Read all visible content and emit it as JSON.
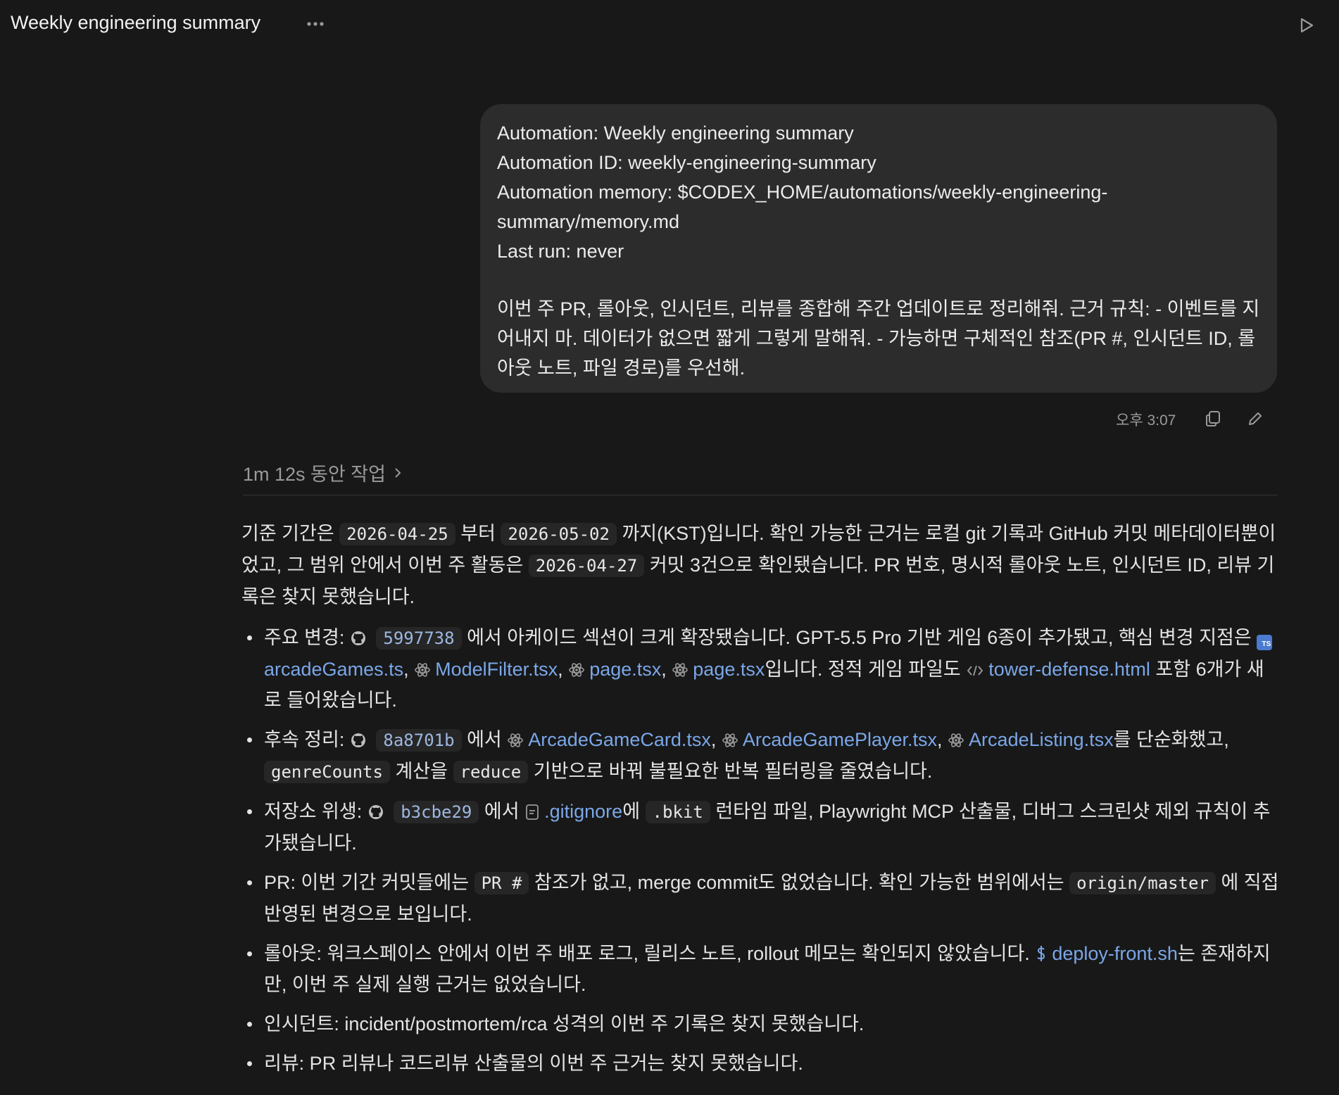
{
  "header": {
    "title": "Weekly engineering summary"
  },
  "message": {
    "line1": "Automation: Weekly engineering summary",
    "line2": "Automation ID: weekly-engineering-summary",
    "line3a": "Automation memory: $CODEX_HOME/automations/weekly-engineering-",
    "line3b": "summary/memory.md",
    "line4": "Last run: never",
    "body": "이번 주 PR, 롤아웃, 인시던트, 리뷰를 종합해 주간 업데이트로 정리해줘. 근거 규칙: - 이벤트를 지어내지 마. 데이터가 없으면 짧게 그렇게 말해줘. - 가능하면 구체적인 참조(PR #, 인시던트 ID, 롤아웃 노트, 파일 경로)를 우선해.",
    "time": "오후 3:07"
  },
  "worked": {
    "label": "1m 12s 동안 작업"
  },
  "answer": {
    "intro_1": "기준 기간은",
    "date_start": "2026-04-25",
    "intro_2": "부터",
    "date_end": "2026-05-02",
    "intro_3": "까지(KST)입니다. 확인 가능한 근거는 로컬 git 기록과 GitHub 커밋 메타데이터뿐이었고, 그 범위 안에서 이번 주 활동은",
    "date_commit": "2026-04-27",
    "intro_4": "커밋 3건으로 확인됐습니다. PR 번호, 명시적 롤아웃 노트, 인시던트 ID, 리뷰 기록은 찾지 못했습니다.",
    "b1": {
      "label": "주요 변경:",
      "sha": "5997738",
      "t1": "에서 아케이드 섹션이 크게 확장됐습니다. GPT-5.5 Pro 기반 게임 6종이 추가됐고, 핵심 변경 지점은",
      "f1": "arcadeGames.ts",
      "f2": "ModelFilter.tsx",
      "f3": "page.tsx",
      "f4": "page.tsx",
      "t2": "입니다. 정적 게임 파일도",
      "f5": "tower-defense.html",
      "t3": "포함 6개가 새로 들어왔습니다."
    },
    "b2": {
      "label": "후속 정리:",
      "sha": "8a8701b",
      "t1": "에서",
      "f1": "ArcadeGameCard.tsx",
      "f2": "ArcadeGamePlayer.tsx",
      "f3": "ArcadeListing.tsx",
      "t2": "를 단순화했고,",
      "c1": "genreCounts",
      "t3": "계산을",
      "c2": "reduce",
      "t4": "기반으로 바꿔 불필요한 반복 필터링을 줄였습니다."
    },
    "b3": {
      "label": "저장소 위생:",
      "sha": "b3cbe29",
      "t1": "에서",
      "f1": ".gitignore",
      "t2": "에",
      "c1": ".bkit",
      "t3": "런타임 파일, Playwright MCP 산출물, 디버그 스크린샷 제외 규칙이 추가됐습니다."
    },
    "b4": {
      "t1": "PR: 이번 기간 커밋들에는",
      "c1": "PR #",
      "t2": "참조가 없고, merge commit도 없었습니다. 확인 가능한 범위에서는",
      "c2": "origin/master",
      "t3": "에 직접 반영된 변경으로 보입니다."
    },
    "b5": {
      "t1": "롤아웃: 워크스페이스 안에서 이번 주 배포 로그, 릴리스 노트, rollout 메모는 확인되지 않았습니다.",
      "f1": "deploy-front.sh",
      "t2": "는 존재하지만, 이번 주 실제 실행 근거는 없었습니다."
    },
    "b6": "인시던트: incident/postmortem/rca 성격의 이번 주 기록은 찾지 못했습니다.",
    "b7": "리뷰: PR 리뷰나 코드리뷰 산출물의 이번 주 근거는 찾지 못했습니다."
  },
  "icons": {
    "more": "more-icon",
    "run": "play-icon",
    "copy": "copy-icon",
    "edit": "pencil-icon",
    "chevron": "chevron-right-icon",
    "github": "github-icon",
    "react": "react-icon",
    "ts": "typescript-icon",
    "html": "code-icon",
    "file": "file-icon",
    "shell": "dollar-icon"
  },
  "colors": {
    "background": "#181818",
    "bubble": "#2c2c2c",
    "link": "#7aa7e8",
    "muted": "#9a9a9a"
  }
}
